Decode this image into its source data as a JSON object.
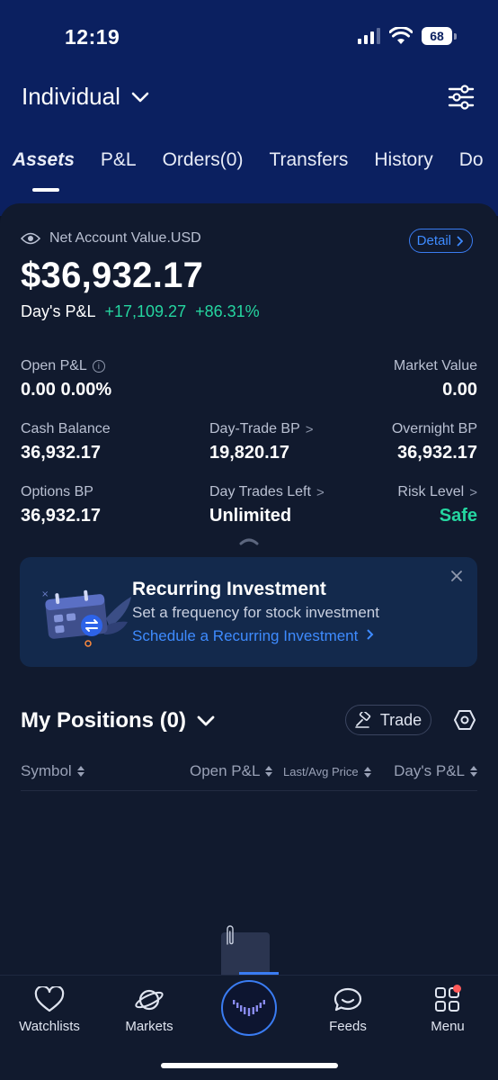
{
  "status_bar": {
    "time": "12:19",
    "battery": "68"
  },
  "header": {
    "account_name": "Individual"
  },
  "tabs": [
    {
      "label": "Assets",
      "active": true
    },
    {
      "label": "P&L"
    },
    {
      "label": "Orders(0)"
    },
    {
      "label": "Transfers"
    },
    {
      "label": "History"
    },
    {
      "label": "Do"
    }
  ],
  "summary": {
    "nav_label": "Net Account Value.USD",
    "detail_label": "Detail",
    "nav_value": "$36,932.17",
    "days_pnl_label": "Day's P&L",
    "days_pnl_value": "+17,109.27",
    "days_pnl_pct": "+86.31%"
  },
  "metrics": {
    "open_pnl": {
      "label": "Open P&L",
      "value": "0.00 0.00%"
    },
    "market_value": {
      "label": "Market Value",
      "value": "0.00"
    },
    "cash_balance": {
      "label": "Cash Balance",
      "value": "36,932.17"
    },
    "day_trade_bp": {
      "label": "Day-Trade BP",
      "value": "19,820.17"
    },
    "overnight_bp": {
      "label": "Overnight BP",
      "value": "36,932.17"
    },
    "options_bp": {
      "label": "Options BP",
      "value": "36,932.17"
    },
    "day_trades_left": {
      "label": "Day Trades Left",
      "value": "Unlimited"
    },
    "risk_level": {
      "label": "Risk Level",
      "value": "Safe"
    }
  },
  "banner": {
    "title": "Recurring Investment",
    "subtitle": "Set a frequency for stock investment",
    "link": "Schedule a Recurring Investment"
  },
  "positions": {
    "title": "My Positions (0)",
    "trade_label": "Trade",
    "columns": [
      "Symbol",
      "Open P&L",
      "Last/Avg Price",
      "Day's P&L"
    ]
  },
  "bottom_nav": [
    {
      "label": "Watchlists",
      "icon": "heart-icon"
    },
    {
      "label": "Markets",
      "icon": "planet-icon"
    },
    {
      "label": "",
      "icon": "home-logo-icon"
    },
    {
      "label": "Feeds",
      "icon": "chat-smile-icon"
    },
    {
      "label": "Menu",
      "icon": "grid-icon"
    }
  ],
  "colors": {
    "header_bg": "#0b2060",
    "card_bg": "#111a2e",
    "gain": "#25d6a0",
    "link": "#3e8bff"
  }
}
